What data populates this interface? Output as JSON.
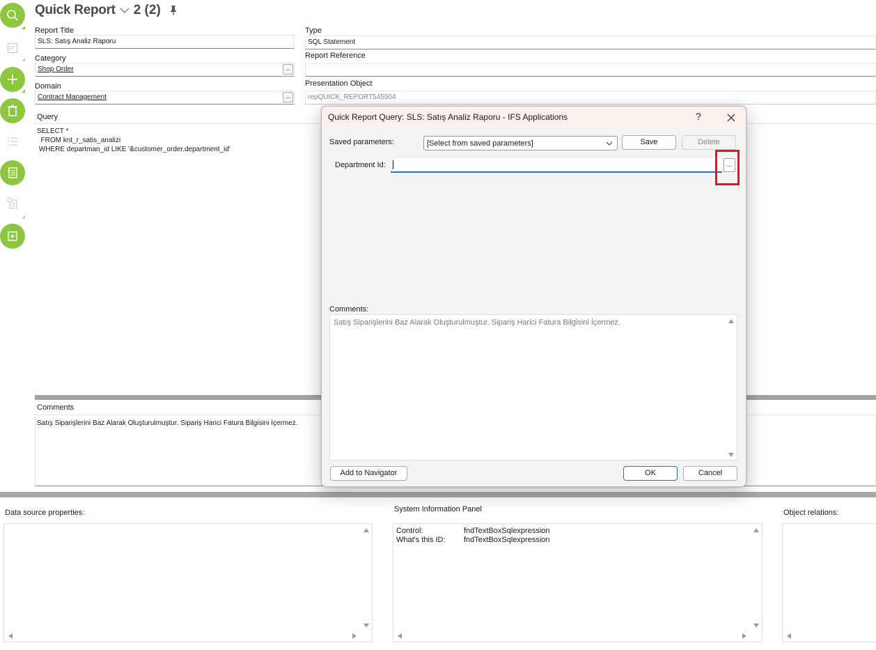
{
  "header": {
    "title": "Quick Report",
    "count": "2 (2)"
  },
  "toolbar": {
    "icons": [
      "search-icon",
      "detail-icon",
      "add-icon",
      "delete-icon",
      "list-icon",
      "report-icon",
      "info-icon",
      "new-report-icon"
    ],
    "accent_color": "#8dc63f"
  },
  "form": {
    "report_title_label": "Report Title",
    "report_title_value": "SLS: Satış Analiz Raporu",
    "category_label": "Category",
    "category_value": "Shop Order",
    "domain_label": "Domain",
    "domain_value": "Contract Management",
    "type_label": "Type",
    "type_value": "SQL Statement",
    "report_reference_label": "Report Reference",
    "report_reference_value": "",
    "presentation_object_label": "Presentation Object",
    "presentation_object_value": "repQUICK_REPORT545504",
    "lov_button": "...",
    "query_label": "Query",
    "query_text": "SELECT *\n  FROM knt_r_satis_analizi\n WHERE departman_id LIKE '&customer_order.department_id'",
    "comments_label": "Comments",
    "comments_text": "Satış Siparişlerini Baz Alarak Oluşturulmuştur. Sipariş Harici Fatura Bilgisini İçermez."
  },
  "bottom_panels": {
    "data_source_label": "Data source properties:",
    "system_info_label": "System Information Panel",
    "object_relations_label": "Object relations:",
    "system_info_rows": [
      {
        "key": "Control:",
        "value": "fndTextBoxSqlexpression"
      },
      {
        "key": "What's this ID:",
        "value": "fndTextBoxSqlexpression"
      }
    ]
  },
  "dialog": {
    "title": "Quick Report Query: SLS: Satış Analiz Raporu - IFS Applications",
    "help": "?",
    "saved_parameters_label": "Saved parameters:",
    "saved_parameters_value": "[Select from saved parameters]",
    "save_label": "Save",
    "delete_label": "Delete",
    "department_id_label": "Department Id:",
    "department_id_value": "",
    "lov_button": "...",
    "comments_label": "Comments:",
    "comments_text": "Satış Siparişlerini Baz Alarak Oluşturulmuştur. Sipariş Harici Fatura Bilgisini İçermez.",
    "add_to_navigator_label": "Add to Navigator",
    "ok_label": "OK",
    "cancel_label": "Cancel",
    "highlight_color": "#e0151f",
    "focus_color": "#2a6fb7"
  }
}
